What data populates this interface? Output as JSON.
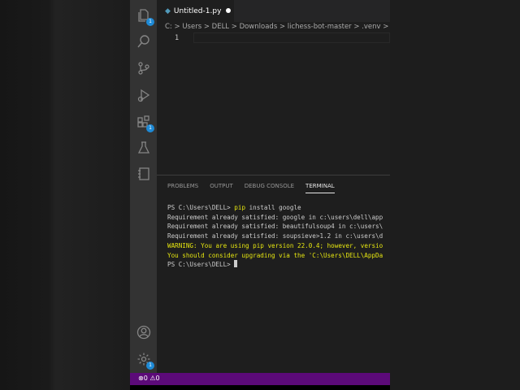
{
  "tab": {
    "label": "Untitled-1.py",
    "icon": "python-file-icon"
  },
  "breadcrumb": "C: > Users > DELL > Downloads > lichess-bot-master > .venv > Lib > si",
  "editor": {
    "line_number": "1"
  },
  "activity": {
    "explorer_badge": "1",
    "extensions_badge": "1",
    "settings_badge": "1"
  },
  "panel": {
    "tabs": [
      "PROBLEMS",
      "OUTPUT",
      "DEBUG CONSOLE",
      "TERMINAL"
    ],
    "active": "TERMINAL"
  },
  "terminal": {
    "prompt1": "PS C:\\Users\\DELL> ",
    "cmd": "pip",
    "args": " install google",
    "lines": [
      "Requirement already satisfied: google in c:\\users\\dell\\app",
      "Requirement already satisfied: beautifulsoup4 in c:\\users\\",
      "Requirement already satisfied: soupsieve>1.2 in c:\\users\\d"
    ],
    "warn1_label": "WARNING",
    "warn1_text": ": You are using pip version 22.0.4; however, versio",
    "warn2": "You should consider upgrading via the 'C:\\Users\\DELL\\AppDa",
    "prompt2": "PS C:\\Users\\DELL> "
  },
  "status": {
    "errors": "0",
    "warnings": "0",
    "color": "#5c0a79"
  }
}
